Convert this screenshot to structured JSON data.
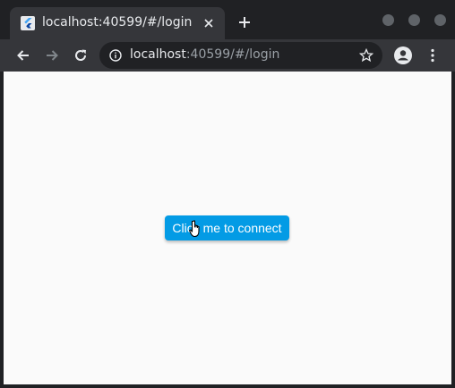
{
  "browser": {
    "tab": {
      "title": "localhost:40599/#/login"
    },
    "address": {
      "host": "localhost",
      "rest": ":40599/#/login"
    }
  },
  "page": {
    "button_label": "Click me to connect"
  },
  "colors": {
    "button": "#039be5",
    "page_background": "#fafafa",
    "chrome_dark": "#202124",
    "toolbar": "#35363a"
  }
}
